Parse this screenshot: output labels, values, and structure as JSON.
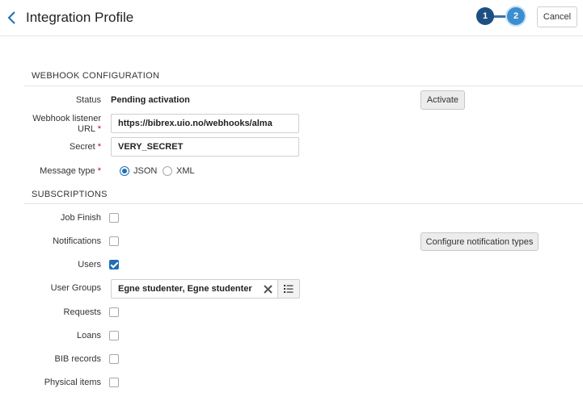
{
  "header": {
    "title": "Integration Profile",
    "steps": [
      "1",
      "2"
    ],
    "cancel_label": "Cancel"
  },
  "webhook": {
    "section_title": "WEBHOOK CONFIGURATION",
    "status_label": "Status",
    "status_value": "Pending activation",
    "activate_label": "Activate",
    "url_label_line1": "Webhook listener",
    "url_label_line2": "URL",
    "url_value": "https://bibrex.uio.no/webhooks/alma",
    "secret_label": "Secret",
    "secret_value": "VERY_SECRET",
    "message_type_label": "Message type",
    "message_type_options": [
      "JSON",
      "XML"
    ],
    "message_type_selected": "JSON",
    "required_mark": "*"
  },
  "subscriptions": {
    "section_title": "SUBSCRIPTIONS",
    "items": [
      {
        "label": "Job Finish",
        "checked": false
      },
      {
        "label": "Notifications",
        "checked": false
      },
      {
        "label": "Users",
        "checked": true
      },
      {
        "label": "User Groups"
      },
      {
        "label": "Requests",
        "checked": false
      },
      {
        "label": "Loans",
        "checked": false
      },
      {
        "label": "BIB records",
        "checked": false
      },
      {
        "label": "Physical items",
        "checked": false
      }
    ],
    "configure_notifications_label": "Configure notification types",
    "user_groups_value": "Egne studenter, Egne studenter – h"
  },
  "icons": {
    "back": "chevron-left-icon",
    "clear": "close-icon",
    "list": "list-icon"
  },
  "colors": {
    "accent": "#1e6fb8",
    "step_active": "#1e4f82",
    "step_current": "#3b8fd0",
    "required": "#d0021b"
  }
}
